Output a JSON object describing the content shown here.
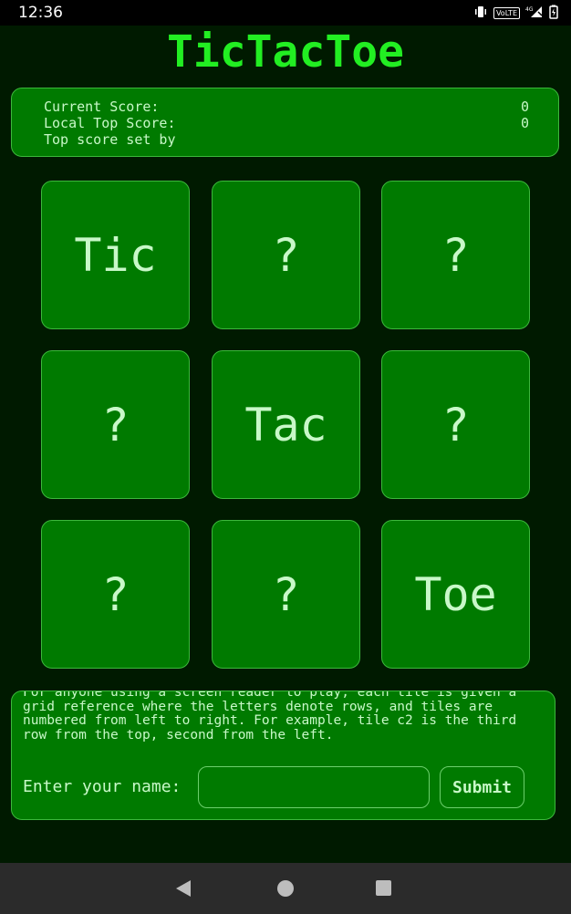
{
  "status_bar": {
    "time": "12:36",
    "icons": [
      "vibrate-icon",
      "volte-icon",
      "signal-4g-icon",
      "battery-icon"
    ],
    "volte_label": "VoLTE",
    "network_label": "4G"
  },
  "app": {
    "title": "TicTacToe"
  },
  "score": {
    "current_label": "Current Score:",
    "current_value": "0",
    "local_top_label": "Local Top Score:",
    "local_top_value": "0",
    "top_set_by_label": "Top score set by"
  },
  "tiles": [
    "Tic",
    "?",
    "?",
    "?",
    "Tac",
    "?",
    "?",
    "?",
    "Toe"
  ],
  "bottom": {
    "info_text": "For anyone using a screen reader to play, each tile is given a grid reference where the letters denote rows, and tiles are numbered from left to right. For example, tile c2 is the third row from the top, second from the left.",
    "name_label": "Enter your name:",
    "name_value": "",
    "submit_label": "Submit"
  },
  "colors": {
    "background": "#001a00",
    "panel": "#007a00",
    "title": "#22ee22",
    "text": "#c8f8c8",
    "nav_bar": "#2b2b2b"
  }
}
